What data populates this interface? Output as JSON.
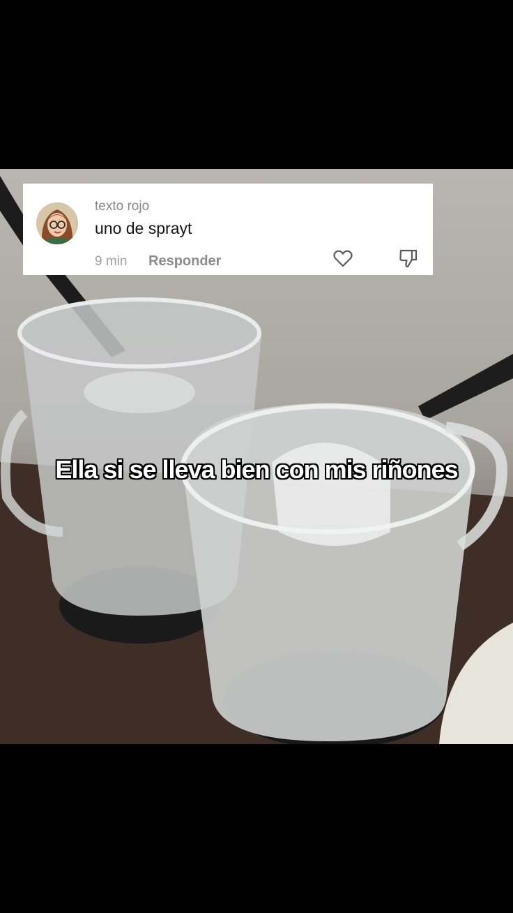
{
  "comment": {
    "username": "texto rojo",
    "text": "uno de sprayt",
    "time": "9 min",
    "reply_label": "Responder",
    "like_icon": "heart-outline-icon",
    "dislike_icon": "thumbs-down-outline-icon"
  },
  "video": {
    "caption": "Ella si se lleva bien con mis riñones"
  },
  "colors": {
    "background": "#000000",
    "card": "#ffffff",
    "caption_text": "#ffffff",
    "caption_stroke": "#000000"
  }
}
